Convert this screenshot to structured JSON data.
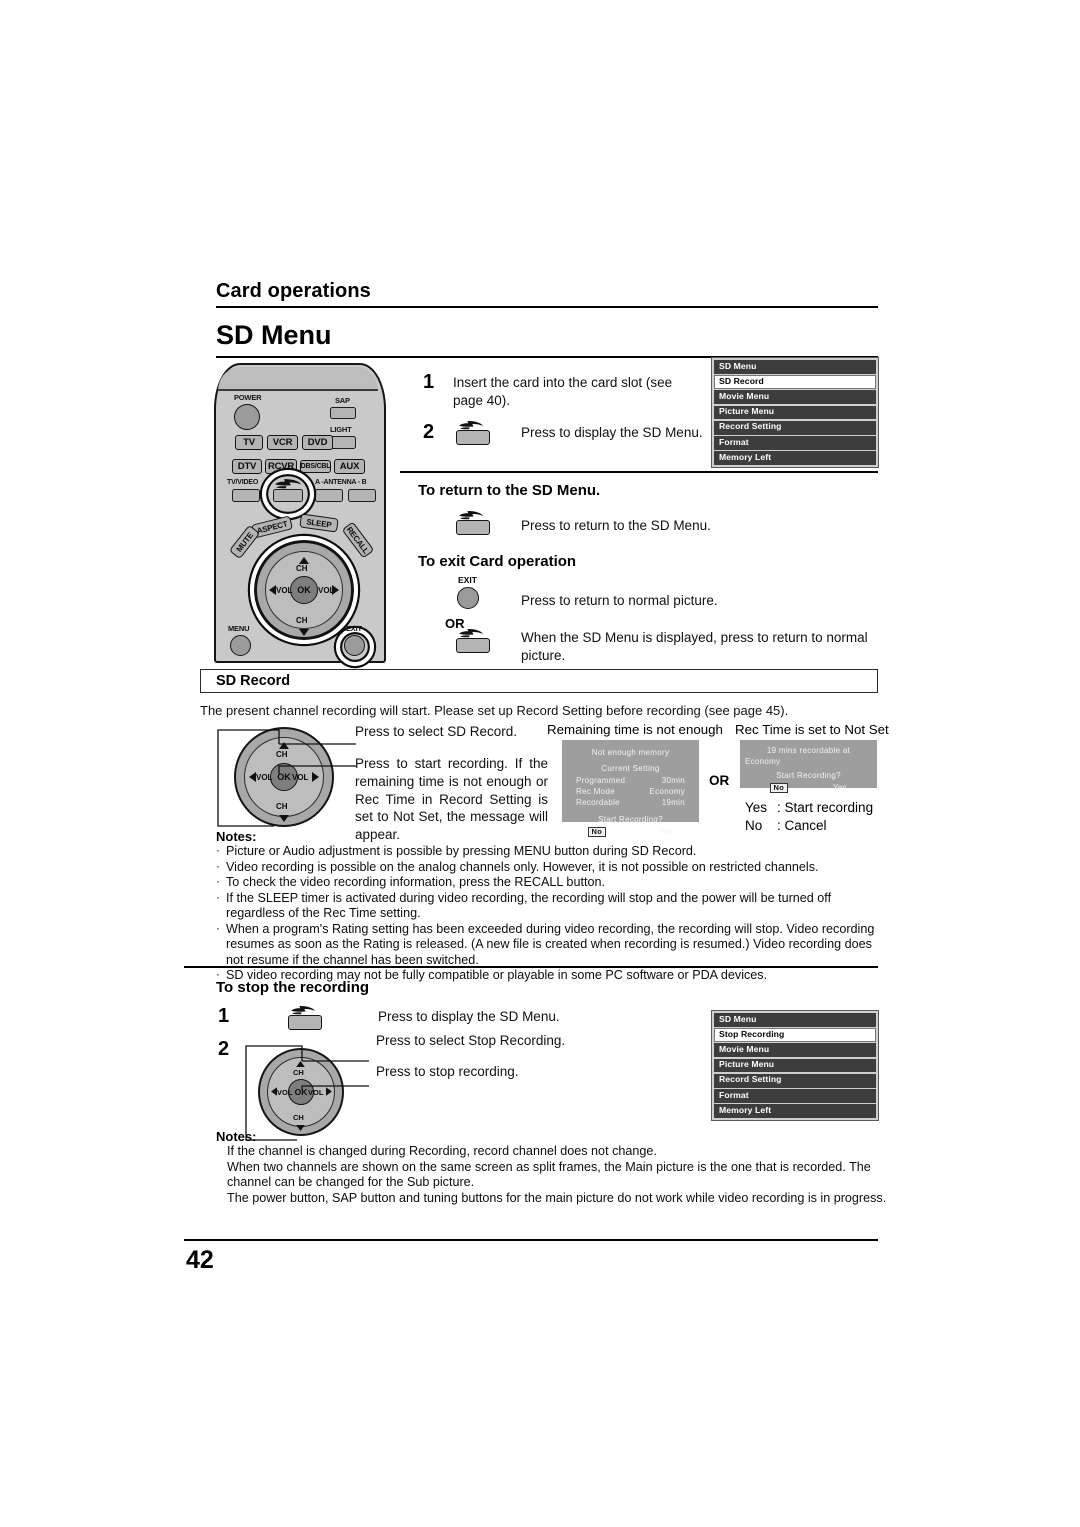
{
  "document": {
    "running_head": "Card operations",
    "page_title": "SD Menu",
    "page_number": "42"
  },
  "remote": {
    "name": "remote-control",
    "labels": {
      "power": "POWER",
      "sap": "SAP",
      "light": "LIGHT",
      "tv": "TV",
      "vcr": "VCR",
      "dvd": "DVD",
      "dtv": "DTV",
      "rcvr": "RCVR",
      "dbscbl": "DBS/CBL",
      "aux": "AUX",
      "tvvideo": "TV/VIDEO",
      "antenna": "A -ANTENNA - B",
      "aspect": "ASPECT",
      "sleep": "SLEEP",
      "mute": "MUTE",
      "recall": "RECALL",
      "ch_up": "CH",
      "ch_down": "CH",
      "vol_left": "VOL",
      "vol_right": "VOL",
      "ok": "OK",
      "menu": "MENU",
      "exit": "EXIT"
    }
  },
  "steps_top": [
    {
      "num": "1",
      "text": "Insert the card into the card slot (see page 40)."
    },
    {
      "num": "2",
      "text": "Press to display the SD Menu.",
      "icon": "sd-card-button-icon"
    }
  ],
  "sd_menu_osd": {
    "title": "SD Menu",
    "items": [
      {
        "label": "SD Menu",
        "selected": false,
        "header": true
      },
      {
        "label": "SD Record",
        "selected": true
      },
      {
        "label": "Movie Menu",
        "selected": false
      },
      {
        "label": "Picture Menu",
        "selected": false
      },
      {
        "label": "Record Setting",
        "selected": false
      },
      {
        "label": "Format",
        "selected": false
      },
      {
        "label": "Memory Left",
        "selected": false
      }
    ]
  },
  "return_section": {
    "heading": "To return to the SD Menu.",
    "instruction": "Press to return to the SD Menu.",
    "icon": "sd-card-button-icon"
  },
  "exit_section": {
    "heading": "To exit Card operation",
    "exit_key_label": "EXIT",
    "exit_instruction": "Press to return to normal picture.",
    "or_label": "OR",
    "sd_instruction": "When the SD Menu is displayed, press to return to normal picture.",
    "icon": "sd-card-button-icon"
  },
  "sd_record": {
    "box_title": "SD Record",
    "intro": "The present channel recording will start. Please set up Record Setting before recording (see page 45).",
    "callout_select": "Press to select SD Record.",
    "callout_start": "Press to start recording. If the remaining time is not enough or Rec Time in Record Setting is set to Not Set, the message will appear.",
    "dialog_left_caption": "Remaining time is not enough",
    "dialog_right_caption": "Rec Time is set to Not Set",
    "or_label": "OR",
    "dialog_left": {
      "title": "Not  enough memory",
      "subtitle": "Current  Setting",
      "rows": [
        {
          "key": "Programmed",
          "value": "30min"
        },
        {
          "key": "Rec Mode",
          "value": "Economy"
        },
        {
          "key": "Recordable",
          "value": "19min"
        }
      ],
      "prompt": "Start  Recording?",
      "no": "No",
      "yes": "Yes"
    },
    "dialog_right": {
      "line1": "19  mins  recordable  at",
      "line2": "Economy",
      "prompt": "Start  Recording?",
      "no": "No",
      "yes": "Yes"
    },
    "legend": [
      {
        "key": "Yes",
        "sep": ":",
        "value": "Start recording"
      },
      {
        "key": "No",
        "sep": ":",
        "value": "Cancel"
      }
    ]
  },
  "notes_1": {
    "heading": "Notes:",
    "items": [
      "Picture or Audio adjustment is possible by pressing MENU button during SD Record.",
      "Video recording is possible on the analog channels only. However, it is not possible on restricted channels.",
      "To check the video recording information, press the RECALL button.",
      "If the SLEEP timer is activated during video recording, the recording will stop and the power will be turned off regardless of the Rec Time setting.",
      "When a program's Rating setting has been exceeded during video recording, the recording will stop. Video recording resumes as soon as the Rating is released. (A new file is created when recording is resumed.) Video recording does not resume if the channel has been switched.",
      "SD video recording may not be fully compatible or playable in some PC software or PDA devices."
    ]
  },
  "stop_section": {
    "heading": "To stop the recording",
    "steps": [
      {
        "num": "1",
        "text": "Press to display the SD Menu.",
        "icon": "sd-card-button-icon"
      },
      {
        "num": "2",
        "text": "Press to select Stop Recording."
      }
    ],
    "callout_stop": "Press to stop recording.",
    "osd": {
      "items": [
        {
          "label": "SD Menu",
          "selected": false,
          "header": true
        },
        {
          "label": "Stop Recording",
          "selected": true
        },
        {
          "label": "Movie Menu",
          "selected": false
        },
        {
          "label": "Picture Menu",
          "selected": false
        },
        {
          "label": "Record Setting",
          "selected": false
        },
        {
          "label": "Format",
          "selected": false
        },
        {
          "label": "Memory Left",
          "selected": false
        }
      ]
    }
  },
  "notes_2": {
    "heading": "Notes:",
    "items": [
      "If the channel is changed during Recording, record channel does not change.",
      "When two channels are shown on the same screen as split frames, the Main picture is the one that is recorded. The channel can be changed for the Sub picture.",
      "The power button, SAP button and tuning buttons for the main picture do not work while video recording is in progress."
    ]
  },
  "colors": {
    "osd_row_bg": "#3d3d3d",
    "osd_panel_bg": "#cfcfcf",
    "dialog_bg": "#9e9e9e",
    "remote_body": "#c9c9c9",
    "ink": "#000000"
  }
}
